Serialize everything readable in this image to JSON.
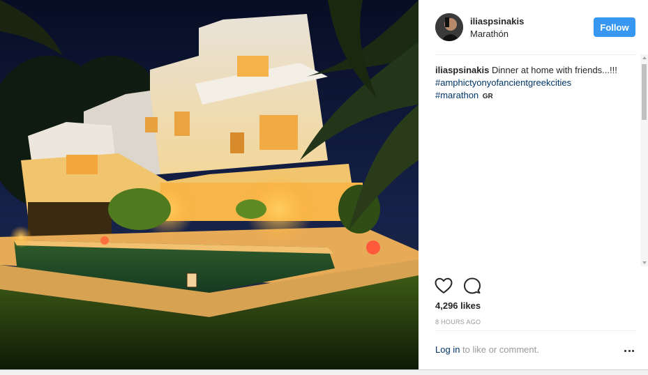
{
  "photo": {
    "alt_icon": "night-villa-photo"
  },
  "header": {
    "username": "iliaspsinakis",
    "location": "Marathón",
    "follow_label": "Follow"
  },
  "caption": {
    "username": "iliaspsinakis",
    "text": " Dinner at home with friends...!!!",
    "hashtag_1": "#amphictyonyofancientgreekcities",
    "hashtag_2": "#marathon",
    "flag": "GR"
  },
  "actions": {
    "like_icon": "heart-icon",
    "comment_icon": "comment-icon"
  },
  "stats": {
    "likes": "4,296 likes",
    "time_ago": "8 HOURS AGO"
  },
  "footer": {
    "login_label": "Log in",
    "login_suffix": " to like or comment.",
    "more_icon": "more-options-icon"
  },
  "colors": {
    "follow_button": "#3897f0",
    "link": "#003569",
    "muted": "#999999",
    "text": "#262626"
  }
}
